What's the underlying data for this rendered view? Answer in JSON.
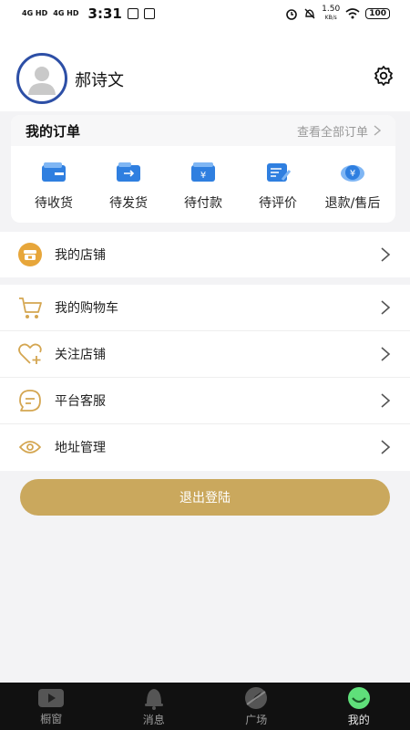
{
  "status": {
    "time": "3:31",
    "signal1": "4G HD",
    "signal2": "4G HD",
    "net_speed": "1.50",
    "net_unit": "KB/s",
    "battery": "100"
  },
  "profile": {
    "name": "郝诗文"
  },
  "orders": {
    "title": "我的订单",
    "view_all": "查看全部订单",
    "items": [
      {
        "label": "待收货",
        "icon": "wallet-icon"
      },
      {
        "label": "待发货",
        "icon": "truck-card-icon"
      },
      {
        "label": "待付款",
        "icon": "payment-icon"
      },
      {
        "label": "待评价",
        "icon": "review-icon"
      },
      {
        "label": "退款/售后",
        "icon": "refund-icon"
      }
    ]
  },
  "menu": {
    "group1": [
      {
        "label": "我的店铺",
        "icon": "store-icon"
      }
    ],
    "group2": [
      {
        "label": "我的购物车",
        "icon": "cart-icon"
      },
      {
        "label": "关注店铺",
        "icon": "heart-plus-icon"
      },
      {
        "label": "平台客服",
        "icon": "chat-icon"
      },
      {
        "label": "地址管理",
        "icon": "location-icon"
      }
    ]
  },
  "logout": {
    "label": "退出登陆"
  },
  "tabs": [
    {
      "label": "橱窗",
      "icon": "play-icon"
    },
    {
      "label": "消息",
      "icon": "bell-icon"
    },
    {
      "label": "广场",
      "icon": "compass-icon"
    },
    {
      "label": "我的",
      "icon": "smile-icon",
      "active": true
    }
  ],
  "colors": {
    "accent": "#caa85d",
    "blue": "#2f7fe0",
    "avatar_ring": "#2d4fa6"
  }
}
